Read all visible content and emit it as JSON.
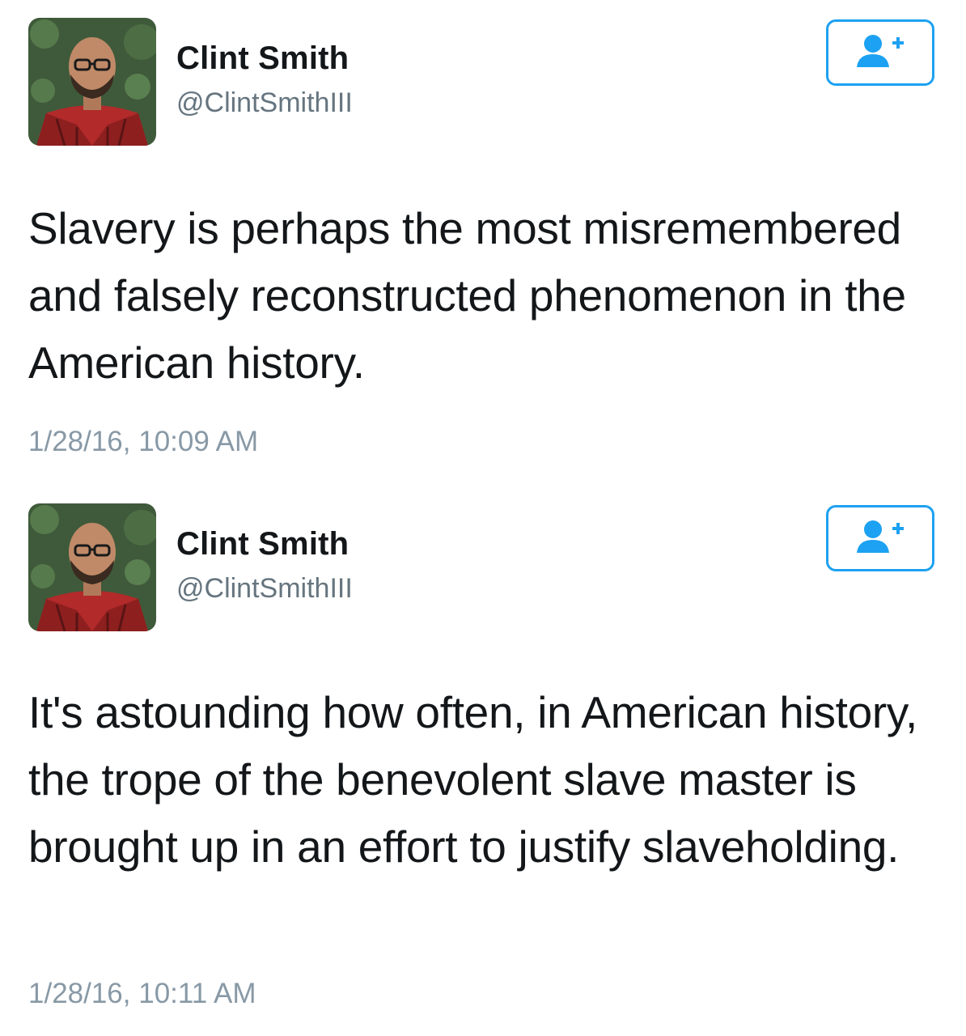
{
  "tweets": [
    {
      "author_name": "Clint Smith",
      "author_handle": "@ClintSmithIII",
      "follow_icon": "add-user-icon",
      "text": "Slavery is perhaps the most misremembered and falsely reconstructed phenomenon in the American history.",
      "timestamp": "1/28/16, 10:09 AM"
    },
    {
      "author_name": "Clint Smith",
      "author_handle": "@ClintSmithIII",
      "follow_icon": "add-user-icon",
      "text": "It's astounding how often, in American history, the trope of the benevolent slave master is brought up in an effort to justify slaveholding.",
      "timestamp": "1/28/16, 10:11 AM"
    }
  ],
  "colors": {
    "accent": "#1da1f2",
    "name": "#14171a",
    "handle": "#66757f",
    "timestamp": "#8899a6"
  }
}
